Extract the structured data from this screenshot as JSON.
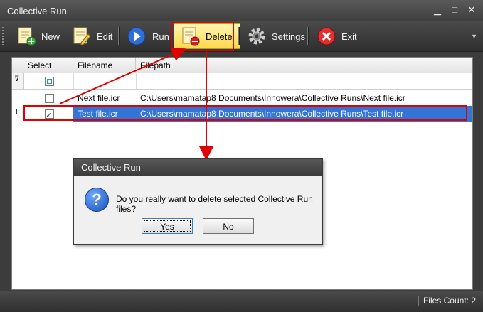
{
  "window": {
    "title": "Collective Run"
  },
  "toolbar": {
    "new_label": "New",
    "edit_label": "Edit",
    "run_label": "Run",
    "delete_label": "Delete",
    "settings_label": "Settings",
    "exit_label": "Exit"
  },
  "grid": {
    "columns": [
      "Select",
      "Filename",
      "Filepath"
    ],
    "rows": [
      {
        "selected": false,
        "filename": "Next file.icr",
        "filepath": "C:\\Users\\mamatap8 Documents\\Innowera\\Collective Runs\\Next file.icr"
      },
      {
        "selected": true,
        "filename": "Test file.icr",
        "filepath": "C:\\Users\\mamatap8 Documents\\Innowera\\Collective Runs\\Test file.icr"
      }
    ]
  },
  "dialog": {
    "title": "Collective Run",
    "message": "Do you really want to delete selected Collective Run files?",
    "yes_label": "Yes",
    "no_label": "No"
  },
  "status": {
    "files_count": "Files Count: 2"
  },
  "colors": {
    "accent": "#3375d6",
    "highlight": "#e00000",
    "delete_button": "#ffd84a"
  }
}
